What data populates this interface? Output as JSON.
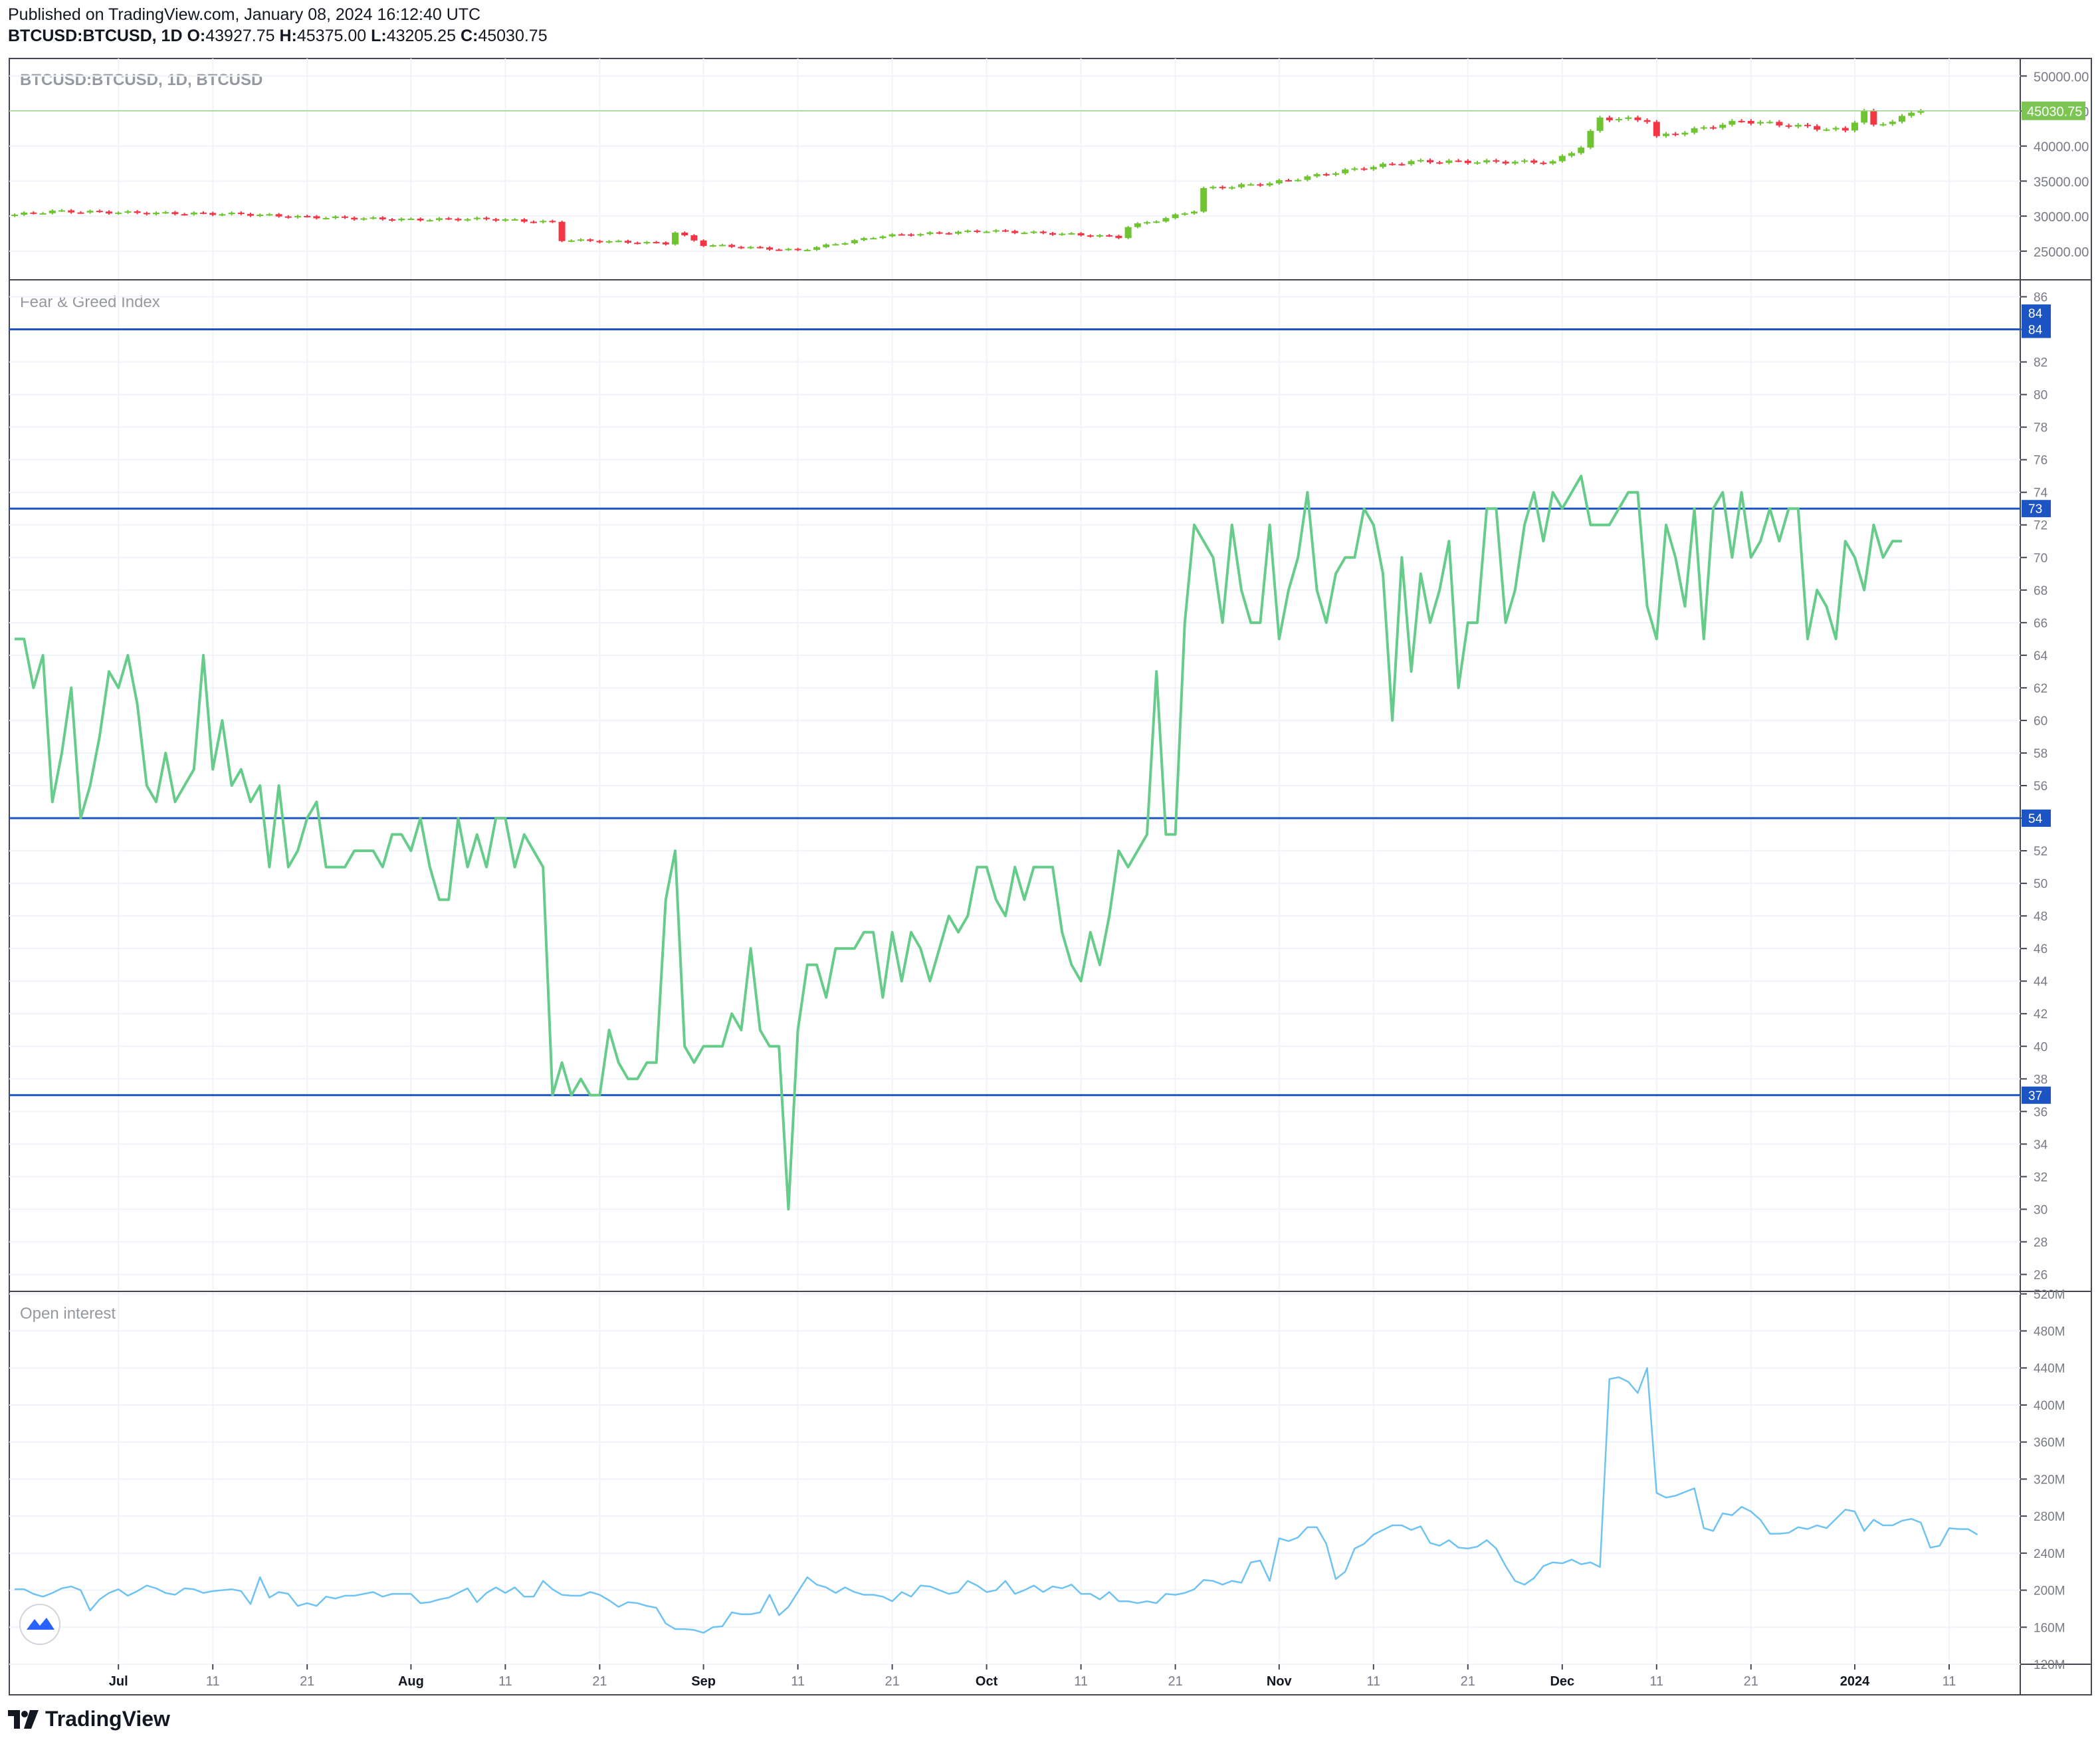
{
  "header": {
    "published": "Published on TradingView.com, January 08, 2024 16:12:40 UTC",
    "symbol": "BTCUSD:BTCUSD, 1D",
    "ohlc": [
      {
        "k": "O:",
        "v": "43927.75"
      },
      {
        "k": "H:",
        "v": "45375.00"
      },
      {
        "k": "L:",
        "v": "43205.25"
      },
      {
        "k": "C:",
        "v": "45030.75"
      }
    ]
  },
  "footer": {
    "brand": "TradingView"
  },
  "colors": {
    "up": "#6fc531",
    "down": "#f23645",
    "fg_line": "#66cc8a",
    "hline": "#1d54c4",
    "oi_line": "#6ec3f2",
    "grid": "#f0f3fa",
    "border": "#434651",
    "axis_text": "#787b86",
    "last_price_bg": "#7cc552"
  },
  "chart_data": [
    {
      "type": "candlestick",
      "title": "BTCUSD:BTCUSD, 1D, BTCUSD",
      "last_price": "45030.75",
      "last_value": 45030.75,
      "ylim": [
        21000,
        52500
      ],
      "yticks": [
        {
          "v": 50000,
          "label": "50000.00"
        },
        {
          "v": 45000,
          "label": "45000.00"
        },
        {
          "v": 40000,
          "label": "40000.00"
        },
        {
          "v": 35000,
          "label": "35000.00"
        },
        {
          "v": 30000,
          "label": "30000.00"
        },
        {
          "v": 25000,
          "label": "25000.00"
        }
      ],
      "close_anchors": [
        {
          "d": "2023-06-20",
          "c": 30200
        },
        {
          "d": "2023-06-24",
          "c": 30700
        },
        {
          "d": "2023-07-06",
          "c": 30400
        },
        {
          "d": "2023-07-14",
          "c": 30300
        },
        {
          "d": "2023-07-20",
          "c": 29900
        },
        {
          "d": "2023-08-01",
          "c": 29500
        },
        {
          "d": "2023-08-09",
          "c": 29600
        },
        {
          "d": "2023-08-16",
          "c": 29100
        },
        {
          "d": "2023-08-17",
          "c": 26600
        },
        {
          "d": "2023-08-28",
          "c": 26100
        },
        {
          "d": "2023-08-29",
          "c": 27700
        },
        {
          "d": "2023-09-01",
          "c": 25900
        },
        {
          "d": "2023-09-11",
          "c": 25100
        },
        {
          "d": "2023-09-20",
          "c": 27200
        },
        {
          "d": "2023-10-01",
          "c": 27900
        },
        {
          "d": "2023-10-10",
          "c": 27400
        },
        {
          "d": "2023-10-15",
          "c": 27000
        },
        {
          "d": "2023-10-16",
          "c": 28500
        },
        {
          "d": "2023-10-20",
          "c": 29700
        },
        {
          "d": "2023-10-23",
          "c": 30800
        },
        {
          "d": "2023-10-24",
          "c": 33900
        },
        {
          "d": "2023-10-31",
          "c": 34700
        },
        {
          "d": "2023-11-09",
          "c": 36700
        },
        {
          "d": "2023-11-15",
          "c": 37800
        },
        {
          "d": "2023-11-30",
          "c": 37700
        },
        {
          "d": "2023-12-03",
          "c": 39900
        },
        {
          "d": "2023-12-05",
          "c": 44000
        },
        {
          "d": "2023-12-10",
          "c": 43700
        },
        {
          "d": "2023-12-11",
          "c": 41300
        },
        {
          "d": "2023-12-20",
          "c": 43600
        },
        {
          "d": "2023-12-31",
          "c": 42200
        },
        {
          "d": "2024-01-02",
          "c": 45000
        },
        {
          "d": "2024-01-03",
          "c": 42800
        },
        {
          "d": "2024-01-08",
          "c": 45030
        }
      ]
    },
    {
      "type": "line",
      "title": "Fear & Greed Index",
      "ylim": [
        25,
        87
      ],
      "yticks": [
        26,
        28,
        30,
        32,
        34,
        36,
        38,
        40,
        42,
        44,
        46,
        48,
        50,
        52,
        54,
        56,
        58,
        60,
        62,
        64,
        66,
        68,
        70,
        72,
        74,
        76,
        78,
        80,
        82,
        84,
        86
      ],
      "hlines": [
        {
          "v": 84,
          "label": "84"
        },
        {
          "v": 73,
          "label": "73"
        },
        {
          "v": 54,
          "label": "54"
        },
        {
          "v": 37,
          "label": "37"
        }
      ],
      "extra_tag": {
        "v": 85,
        "label": "84"
      },
      "start_date": "2023-06-20",
      "values": [
        65,
        65,
        62,
        64,
        55,
        58,
        62,
        54,
        56,
        59,
        63,
        62,
        64,
        61,
        56,
        55,
        58,
        55,
        56,
        57,
        64,
        57,
        60,
        56,
        57,
        55,
        56,
        51,
        56,
        51,
        52,
        54,
        55,
        51,
        51,
        51,
        52,
        52,
        52,
        51,
        53,
        53,
        52,
        54,
        51,
        49,
        49,
        54,
        51,
        53,
        51,
        54,
        54,
        51,
        53,
        52,
        51,
        37,
        39,
        37,
        38,
        37,
        37,
        41,
        39,
        38,
        38,
        39,
        39,
        49,
        52,
        40,
        39,
        40,
        40,
        40,
        42,
        41,
        46,
        41,
        40,
        40,
        30,
        41,
        45,
        45,
        43,
        46,
        46,
        46,
        47,
        47,
        43,
        47,
        44,
        47,
        46,
        44,
        46,
        48,
        47,
        48,
        51,
        51,
        49,
        48,
        51,
        49,
        51,
        51,
        51,
        47,
        45,
        44,
        47,
        45,
        48,
        52,
        51,
        52,
        53,
        63,
        53,
        53,
        66,
        72,
        71,
        70,
        66,
        72,
        68,
        66,
        66,
        72,
        65,
        68,
        70,
        74,
        68,
        66,
        69,
        70,
        70,
        73,
        72,
        69,
        60,
        70,
        63,
        69,
        66,
        68,
        71,
        62,
        66,
        66,
        73,
        73,
        66,
        68,
        72,
        74,
        71,
        74,
        73,
        74,
        75,
        72,
        72,
        72,
        73,
        74,
        74,
        67,
        65,
        72,
        70,
        67,
        73,
        65,
        73,
        74,
        70,
        74,
        70,
        71,
        73,
        71,
        73,
        73,
        65,
        68,
        67,
        65,
        71,
        70,
        68,
        72,
        70,
        71,
        71
      ]
    },
    {
      "type": "line",
      "title": "Open interest",
      "ylim": [
        120,
        522
      ],
      "yticks": [
        {
          "v": 520,
          "label": "520M"
        },
        {
          "v": 480,
          "label": "480M"
        },
        {
          "v": 440,
          "label": "440M"
        },
        {
          "v": 400,
          "label": "400M"
        },
        {
          "v": 360,
          "label": "360M"
        },
        {
          "v": 320,
          "label": "320M"
        },
        {
          "v": 280,
          "label": "280M"
        },
        {
          "v": 240,
          "label": "240M"
        },
        {
          "v": 200,
          "label": "200M"
        },
        {
          "v": 160,
          "label": "160M"
        },
        {
          "v": 120,
          "label": "120M"
        }
      ],
      "start_date": "2023-06-20",
      "values": [
        201,
        201,
        196,
        193,
        197,
        202,
        204,
        200,
        178,
        190,
        197,
        201,
        194,
        199,
        205,
        202,
        197,
        195,
        202,
        201,
        197,
        199,
        200,
        201,
        199,
        185,
        214,
        192,
        198,
        196,
        183,
        186,
        183,
        193,
        191,
        194,
        194,
        196,
        198,
        193,
        196,
        196,
        196,
        186,
        187,
        190,
        192,
        197,
        202,
        187,
        197,
        203,
        197,
        203,
        193,
        193,
        210,
        201,
        195,
        194,
        194,
        198,
        195,
        189,
        182,
        187,
        186,
        183,
        181,
        164,
        158,
        158,
        157,
        154,
        160,
        161,
        176,
        174,
        174,
        176,
        195,
        173,
        182,
        198,
        214,
        206,
        203,
        197,
        203,
        198,
        195,
        195,
        193,
        188,
        198,
        193,
        205,
        204,
        200,
        196,
        198,
        210,
        205,
        198,
        200,
        210,
        196,
        200,
        205,
        198,
        204,
        202,
        206,
        196,
        196,
        190,
        198,
        188,
        188,
        186,
        188,
        186,
        196,
        195,
        197,
        201,
        211,
        210,
        206,
        210,
        208,
        230,
        232,
        210,
        256,
        253,
        257,
        268,
        268,
        250,
        212,
        220,
        245,
        250,
        260,
        265,
        270,
        270,
        265,
        269,
        251,
        248,
        254,
        246,
        245,
        247,
        254,
        245,
        226,
        210,
        206,
        213,
        226,
        230,
        229,
        233,
        228,
        230,
        225,
        428,
        430,
        425,
        413,
        440,
        305,
        300,
        302,
        306,
        310,
        267,
        264,
        283,
        281,
        290,
        285,
        276,
        261,
        261,
        262,
        268,
        266,
        270,
        267,
        277,
        287,
        285,
        264,
        276,
        270,
        270,
        275,
        277,
        273,
        246,
        248,
        267,
        266,
        266,
        260
      ]
    },
    {
      "type": "x_axis",
      "ticks": [
        {
          "d": "2023-07-01",
          "label": "Jul",
          "major": true
        },
        {
          "d": "2023-07-11",
          "label": "11",
          "major": false
        },
        {
          "d": "2023-07-21",
          "label": "21",
          "major": false
        },
        {
          "d": "2023-08-01",
          "label": "Aug",
          "major": true
        },
        {
          "d": "2023-08-11",
          "label": "11",
          "major": false
        },
        {
          "d": "2023-08-21",
          "label": "21",
          "major": false
        },
        {
          "d": "2023-09-01",
          "label": "Sep",
          "major": true
        },
        {
          "d": "2023-09-11",
          "label": "11",
          "major": false
        },
        {
          "d": "2023-09-21",
          "label": "21",
          "major": false
        },
        {
          "d": "2023-10-01",
          "label": "Oct",
          "major": true
        },
        {
          "d": "2023-10-11",
          "label": "11",
          "major": false
        },
        {
          "d": "2023-10-21",
          "label": "21",
          "major": false
        },
        {
          "d": "2023-11-01",
          "label": "Nov",
          "major": true
        },
        {
          "d": "2023-11-11",
          "label": "11",
          "major": false
        },
        {
          "d": "2023-11-21",
          "label": "21",
          "major": false
        },
        {
          "d": "2023-12-01",
          "label": "Dec",
          "major": true
        },
        {
          "d": "2023-12-11",
          "label": "11",
          "major": false
        },
        {
          "d": "2023-12-21",
          "label": "21",
          "major": false
        },
        {
          "d": "2024-01-01",
          "label": "2024",
          "major": true
        },
        {
          "d": "2024-01-11",
          "label": "11",
          "major": false
        }
      ]
    }
  ]
}
